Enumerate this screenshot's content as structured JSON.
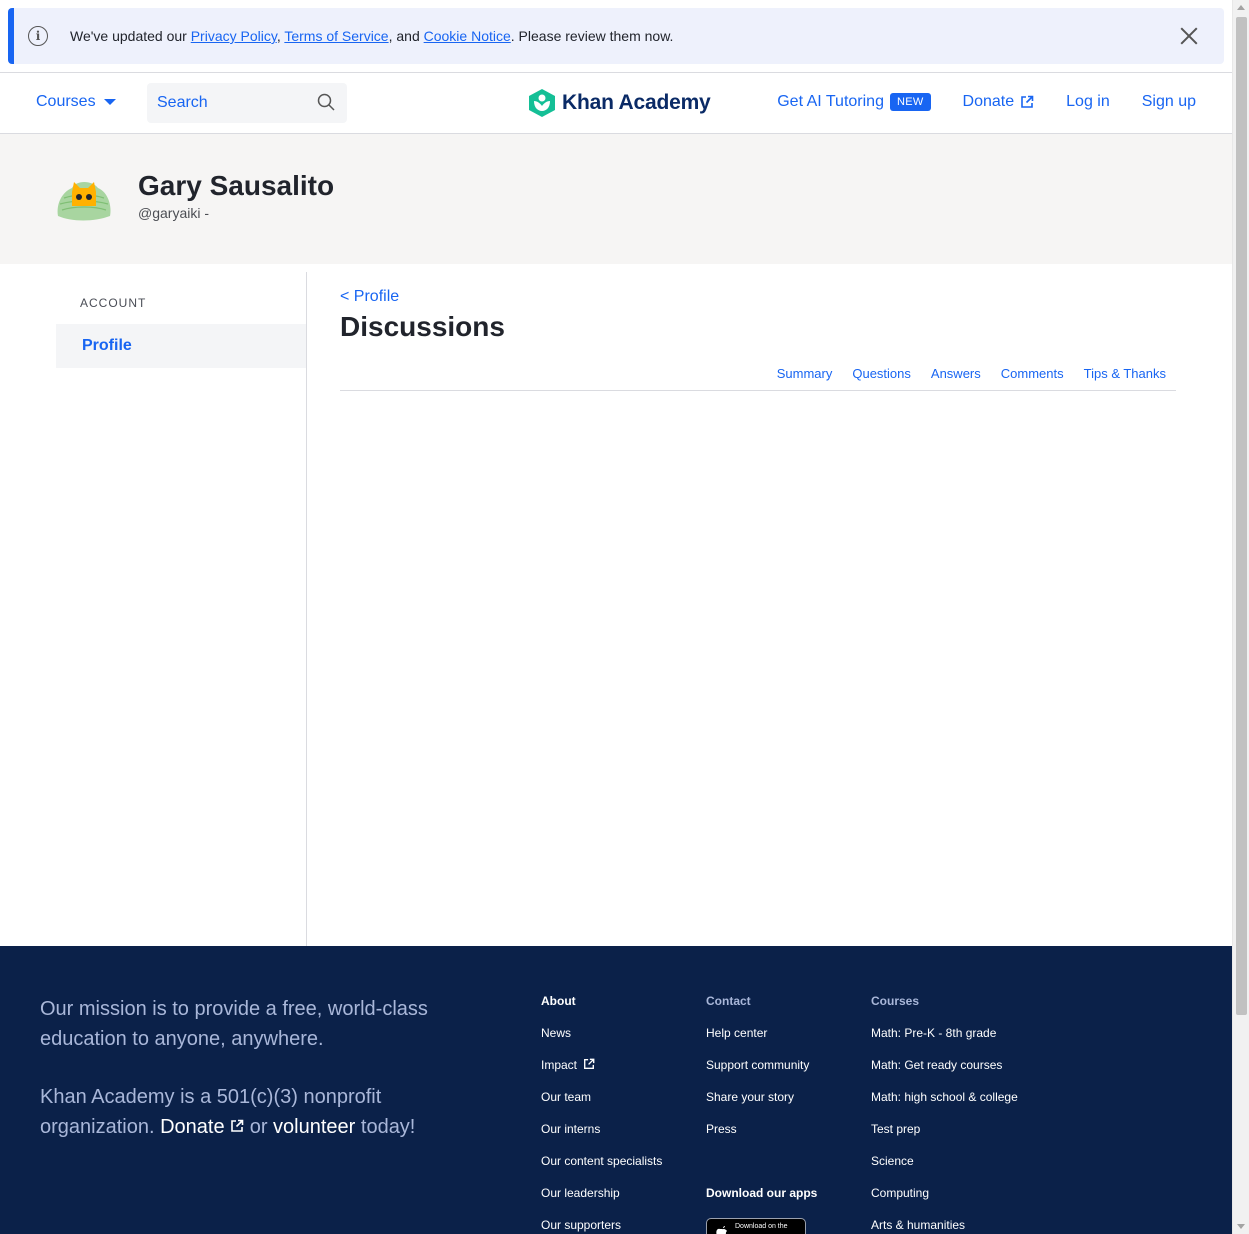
{
  "notice": {
    "text_before": "We've updated our ",
    "privacy": "Privacy Policy",
    "sep1": ", ",
    "terms": "Terms of Service",
    "sep2": ", and ",
    "cookie": "Cookie Notice",
    "text_after": ". Please review them now."
  },
  "header": {
    "courses": "Courses",
    "search_placeholder": "Search",
    "logo": "Khan Academy",
    "ai_tutoring": "Get AI Tutoring",
    "new_badge": "NEW",
    "donate": "Donate",
    "login": "Log in",
    "signup": "Sign up"
  },
  "profile": {
    "name": "Gary Sausalito",
    "handle": "@garyaiki -"
  },
  "sidebar": {
    "section": "ACCOUNT",
    "items": [
      {
        "label": "Profile"
      }
    ]
  },
  "main": {
    "back": "< Profile",
    "title": "Discussions",
    "tabs": [
      "Summary",
      "Questions",
      "Answers",
      "Comments",
      "Tips & Thanks"
    ]
  },
  "footer": {
    "mission": "Our mission is to provide a free, world-class education to anyone, anywhere.",
    "nonprofit_a": "Khan Academy is a 501(c)(3) nonprofit organization. ",
    "donate": "Donate",
    "or": " or ",
    "volunteer": "volunteer",
    "today": " today!",
    "about": {
      "head": "About",
      "links": [
        "News",
        "Impact",
        "Our team",
        "Our interns",
        "Our content specialists",
        "Our leadership",
        "Our supporters"
      ]
    },
    "contact": {
      "head": "Contact",
      "links": [
        "Help center",
        "Support community",
        "Share your story",
        "Press"
      ]
    },
    "courses": {
      "head": "Courses",
      "links": [
        "Math: Pre-K - 8th grade",
        "Math: Get ready courses",
        "Math: high school & college",
        "Test prep",
        "Science",
        "Computing",
        "Arts & humanities"
      ]
    },
    "apps_head": "Download our apps",
    "appstore": "Download on the"
  },
  "colors": {
    "accent": "#1865f2",
    "footer_bg": "#0b2149",
    "banner_bg": "#f6f5f4",
    "logo_green": "#14bf96"
  }
}
